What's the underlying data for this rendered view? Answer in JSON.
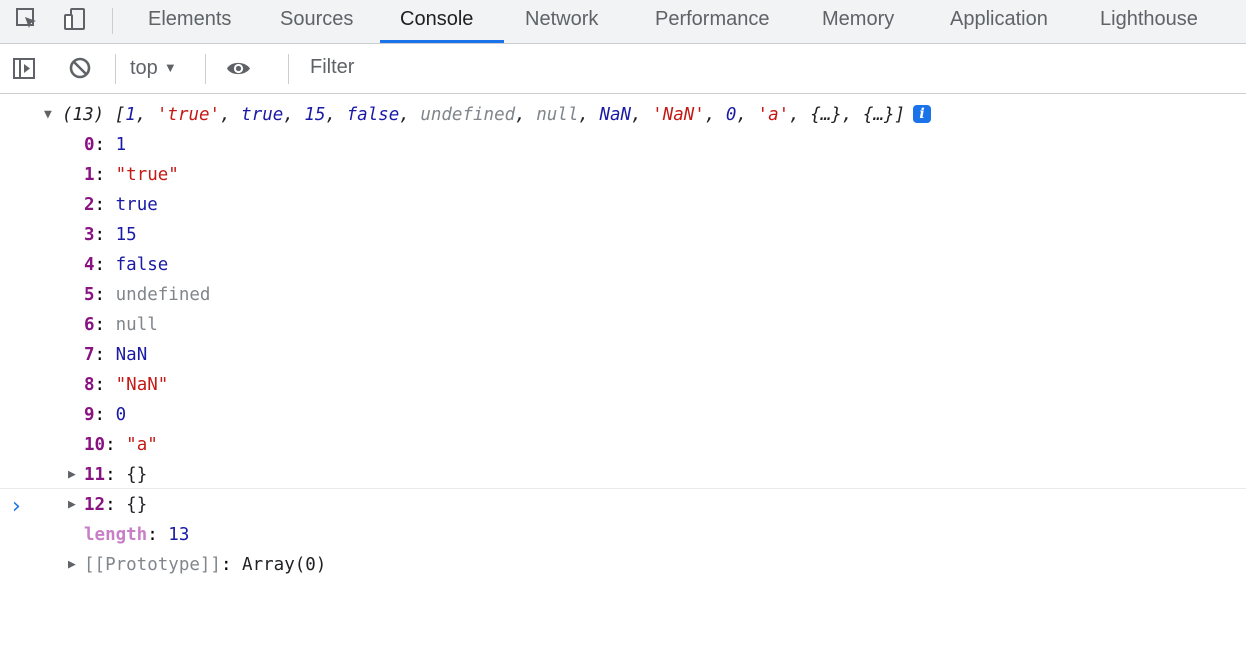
{
  "tabs": [
    "Elements",
    "Sources",
    "Console",
    "Network",
    "Performance",
    "Memory",
    "Application",
    "Lighthouse"
  ],
  "active_tab": "Console",
  "toolbar": {
    "context_label": "top",
    "context_arrow": "▼",
    "filter_placeholder": "Filter"
  },
  "console": {
    "summary": {
      "count": "(13)",
      "open": "[",
      "items": [
        {
          "text": "1",
          "kind": "num"
        },
        {
          "text": "'true'",
          "kind": "str"
        },
        {
          "text": "true",
          "kind": "kw"
        },
        {
          "text": "15",
          "kind": "num"
        },
        {
          "text": "false",
          "kind": "kw"
        },
        {
          "text": "undefined",
          "kind": "undef"
        },
        {
          "text": "null",
          "kind": "null"
        },
        {
          "text": "NaN",
          "kind": "kw"
        },
        {
          "text": "'NaN'",
          "kind": "str"
        },
        {
          "text": "0",
          "kind": "num"
        },
        {
          "text": "'a'",
          "kind": "str"
        },
        {
          "text": "{…}",
          "kind": "obj"
        },
        {
          "text": "{…}",
          "kind": "obj"
        }
      ],
      "close": "]",
      "info": "i"
    },
    "entries": [
      {
        "key": "0",
        "value": "1",
        "kind": "num",
        "expandable": false
      },
      {
        "key": "1",
        "value": "\"true\"",
        "kind": "str",
        "expandable": false
      },
      {
        "key": "2",
        "value": "true",
        "kind": "num",
        "expandable": false
      },
      {
        "key": "3",
        "value": "15",
        "kind": "num",
        "expandable": false
      },
      {
        "key": "4",
        "value": "false",
        "kind": "num",
        "expandable": false
      },
      {
        "key": "5",
        "value": "undefined",
        "kind": "grey",
        "expandable": false
      },
      {
        "key": "6",
        "value": "null",
        "kind": "grey",
        "expandable": false
      },
      {
        "key": "7",
        "value": "NaN",
        "kind": "num",
        "expandable": false
      },
      {
        "key": "8",
        "value": "\"NaN\"",
        "kind": "str",
        "expandable": false
      },
      {
        "key": "9",
        "value": "0",
        "kind": "num",
        "expandable": false
      },
      {
        "key": "10",
        "value": "\"a\"",
        "kind": "str",
        "expandable": false
      },
      {
        "key": "11",
        "value": "{}",
        "kind": "plain",
        "expandable": true
      },
      {
        "key": "12",
        "value": "{}",
        "kind": "plain",
        "expandable": true
      },
      {
        "key": "length",
        "value": "13",
        "kind": "num",
        "expandable": false,
        "meta": true
      },
      {
        "key": "[[Prototype]]",
        "value": "Array(0)",
        "kind": "plain",
        "expandable": true,
        "proto": true
      }
    ],
    "prompt": "›"
  },
  "colors": {
    "accent": "#1a73e8",
    "string": "#c41a16",
    "number": "#1a1aa6",
    "key": "#881280"
  }
}
